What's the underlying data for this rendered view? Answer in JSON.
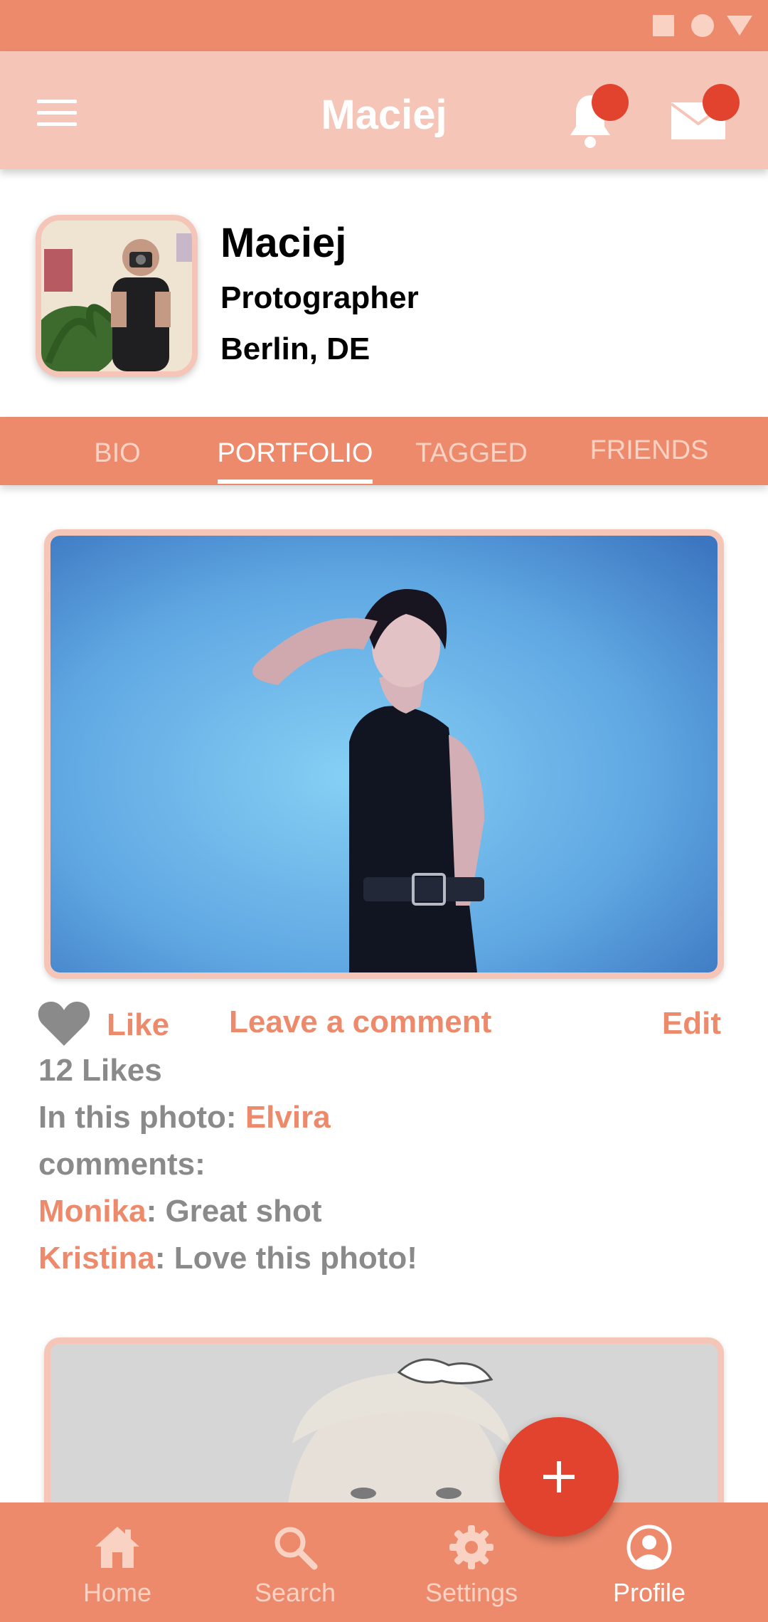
{
  "app_bar": {
    "title": "Maciej"
  },
  "profile": {
    "name": "Maciej",
    "occupation": "Protographer",
    "location": "Berlin, DE"
  },
  "tabs": [
    {
      "label": "BIO",
      "active": false
    },
    {
      "label": "PORTFOLIO",
      "active": true
    },
    {
      "label": "TAGGED",
      "active": false
    },
    {
      "label": "FRIENDS",
      "active": false
    }
  ],
  "post": {
    "like_label": "Like",
    "comment_label": "Leave a comment",
    "edit_label": "Edit",
    "likes_text": "12 Likes",
    "in_photo_prefix": "In this photo: ",
    "in_photo_name": "Elvira",
    "comments_heading": "comments:",
    "comments": [
      {
        "author": "Monika",
        "text": ": Great shot"
      },
      {
        "author": "Kristina",
        "text": ": Love this photo!"
      }
    ]
  },
  "nav": [
    {
      "label": "Home",
      "icon": "home-icon",
      "active": false
    },
    {
      "label": "Search",
      "icon": "search-icon",
      "active": false
    },
    {
      "label": "Settings",
      "icon": "gear-icon",
      "active": false
    },
    {
      "label": "Profile",
      "icon": "profile-icon",
      "active": true
    }
  ],
  "fab": {
    "icon": "plus-icon"
  },
  "colors": {
    "primary": "#EE8A6C",
    "light": "#F5C6B8",
    "accent": "#E2432F"
  }
}
